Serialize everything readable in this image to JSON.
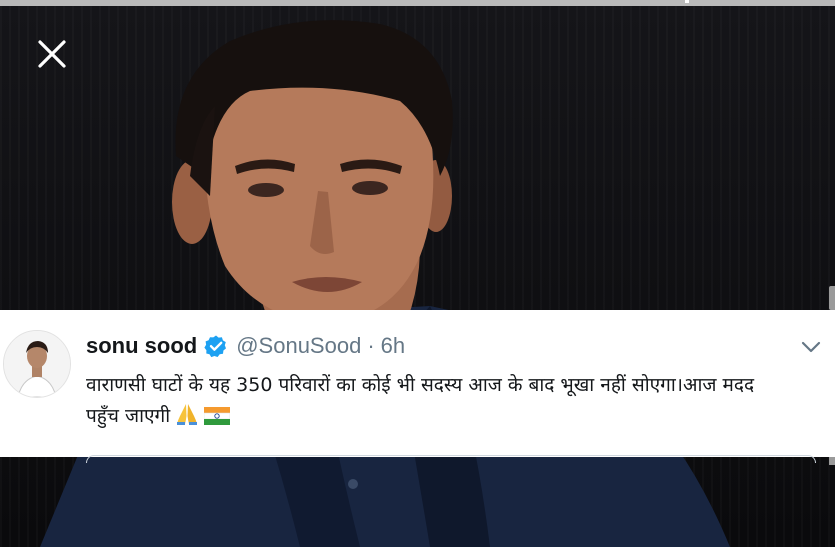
{
  "overlay": {
    "close_icon": "close-icon"
  },
  "tweet": {
    "author_name": "sonu sood",
    "verified_icon": "verified-badge-icon",
    "handle": "@SonuSood",
    "separator": "·",
    "timestamp": "6h",
    "menu_icon": "chevron-down-icon",
    "text_line_1": "वाराणसी घाटों के यह 350 परिवारों का कोई भी सदस्य आज के बाद भूखा नहीं सोएगा।आज मदद",
    "text_line_2": "पहुँच जाएगी",
    "emoji_1": "folded-hands-emoji",
    "emoji_2": "india-flag-emoji"
  },
  "colors": {
    "name": "#14171a",
    "meta": "#657786",
    "verified": "#1da1f2",
    "card_background": "#ffffff"
  }
}
